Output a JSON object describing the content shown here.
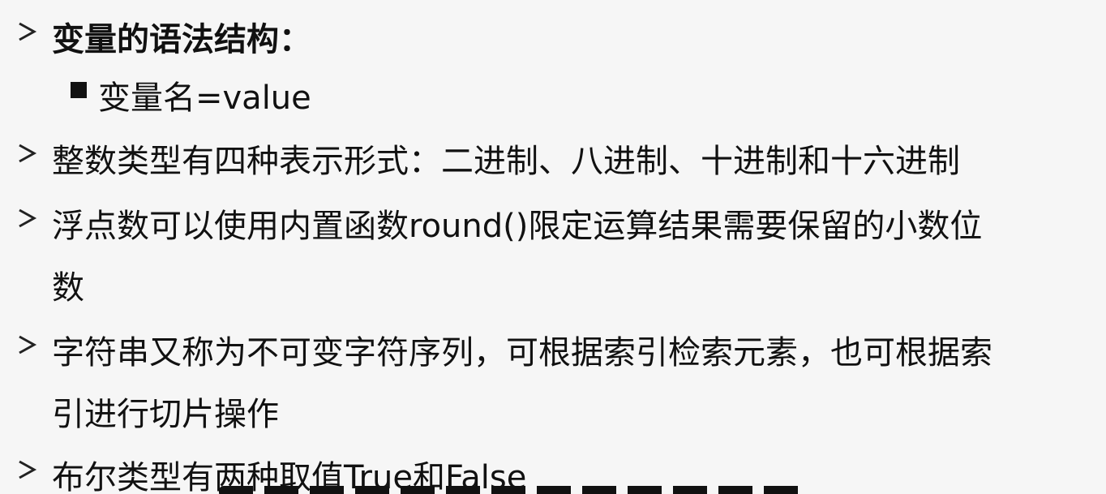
{
  "bullets": [
    {
      "marker": "arrow-icon",
      "text": "变量的语法结构：",
      "bold": true
    },
    {
      "marker": "square-bullet-icon",
      "text": "变量名=value"
    },
    {
      "marker": "arrow-icon",
      "text": "整数类型有四种表示形式：二进制、八进制、十进制和十六进制"
    },
    {
      "marker": "arrow-icon",
      "text_line1": "浮点数可以使用内置函数round()限定运算结果需要保留的小数位",
      "text_line2": "数"
    },
    {
      "marker": "arrow-icon",
      "text_line1": "字符串又称为不可变字符序列，可根据索引检索元素，也可根据索",
      "text_line2": "引进行切片操作"
    },
    {
      "marker": "arrow-icon",
      "text": "布尔类型有两种取值True和False"
    }
  ]
}
